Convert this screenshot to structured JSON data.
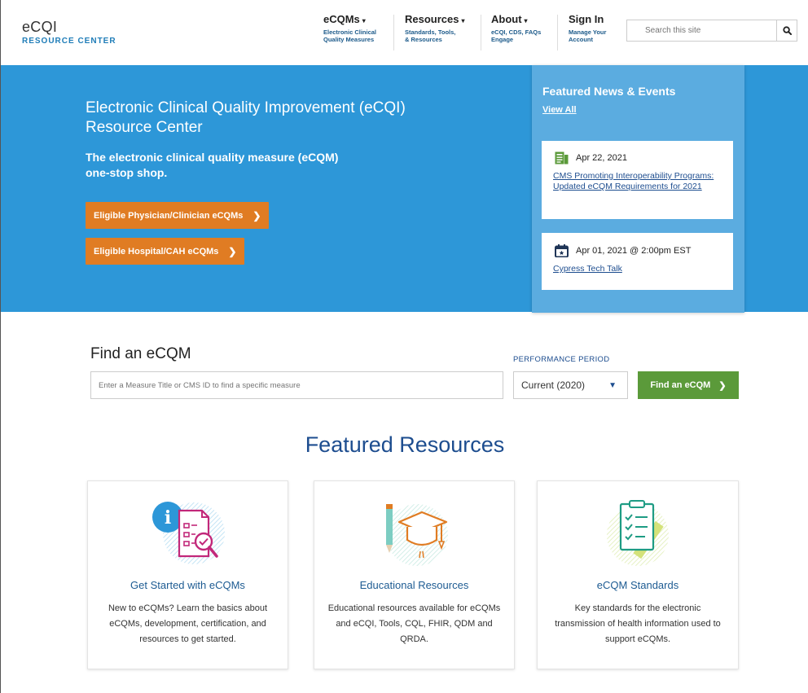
{
  "header": {
    "logo_top": "eCQI",
    "logo_bottom": "RESOURCE CENTER",
    "nav": [
      {
        "title": "eCQMs",
        "sub1": "Electronic Clinical",
        "sub2": "Quality Measures"
      },
      {
        "title": "Resources",
        "sub1": "Standards, Tools,",
        "sub2": "& Resources"
      },
      {
        "title": "About",
        "sub1": "eCQI, CDS, FAQs",
        "sub2": "Engage"
      },
      {
        "title": "Sign In",
        "sub1": "Manage Your",
        "sub2": "Account"
      }
    ],
    "search_placeholder": "Search this site"
  },
  "hero": {
    "title": "Electronic Clinical Quality Improvement (eCQI) Resource Center",
    "subtitle": "The electronic clinical quality measure (eCQM) one-stop shop.",
    "button1": "Eligible Physician/Clinician eCQMs",
    "button2": "Eligible Hospital/CAH eCQMs"
  },
  "news": {
    "title": "Featured News & Events",
    "view_all": "View All",
    "items": [
      {
        "date": "Apr 22, 2021",
        "link": "CMS Promoting Interoperability Programs: Updated eCQM Requirements for 2021"
      },
      {
        "date": "Apr 01, 2021 @ 2:00pm EST",
        "link": "Cypress Tech Talk"
      }
    ]
  },
  "find": {
    "title": "Find an eCQM",
    "input_placeholder": "Enter a Measure Title or CMS ID to find a specific measure",
    "period_label": "PERFORMANCE PERIOD",
    "period_value": "Current (2020)",
    "button": "Find an eCQM"
  },
  "featured": {
    "title": "Featured Resources",
    "cards": [
      {
        "title": "Get Started with eCQMs",
        "text": "New to eCQMs? Learn the basics about eCQMs, development, certification, and resources to get started."
      },
      {
        "title": "Educational Resources",
        "text": "Educational resources available for eCQMs and eCQI, Tools, CQL, FHIR, QDM and QRDA."
      },
      {
        "title": "eCQM Standards",
        "text": "Key standards for the electronic transmission of health information used to support eCQMs."
      }
    ]
  },
  "colors": {
    "hero_blue": "#2d97d8",
    "orange": "#e07c23",
    "green": "#5b9a3a",
    "navy_link": "#1d4d8f"
  }
}
